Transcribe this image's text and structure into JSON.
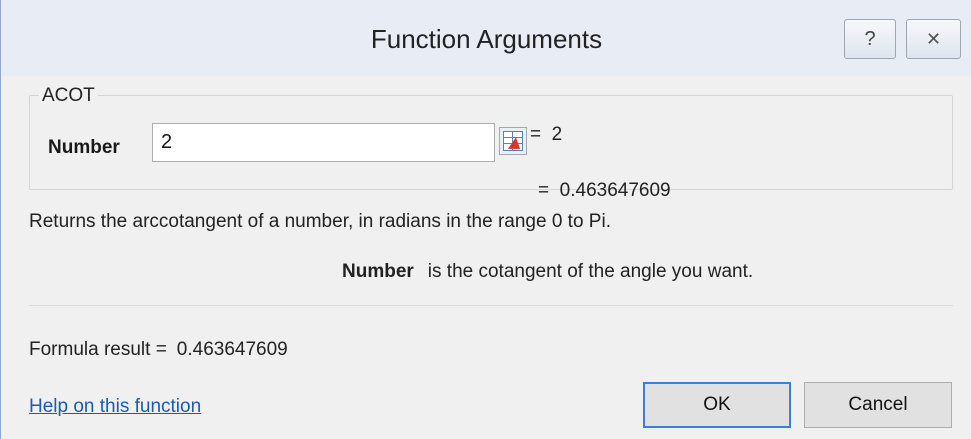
{
  "dialog": {
    "title": "Function Arguments",
    "help_icon": "?",
    "close_icon": "✕"
  },
  "function": {
    "name": "ACOT",
    "argument": {
      "label": "Number",
      "value": "2",
      "evaluated": "=  2"
    },
    "result_preview": "=  0.463647609",
    "description": "Returns the arccotangent of a number, in radians in the range 0 to Pi.",
    "argument_help": {
      "name": "Number",
      "text": "is the cotangent of the angle you want."
    }
  },
  "formula_result": {
    "label": "Formula result =",
    "value": "0.463647609"
  },
  "footer": {
    "help_link": "Help on this function",
    "ok_label": "OK",
    "cancel_label": "Cancel"
  }
}
